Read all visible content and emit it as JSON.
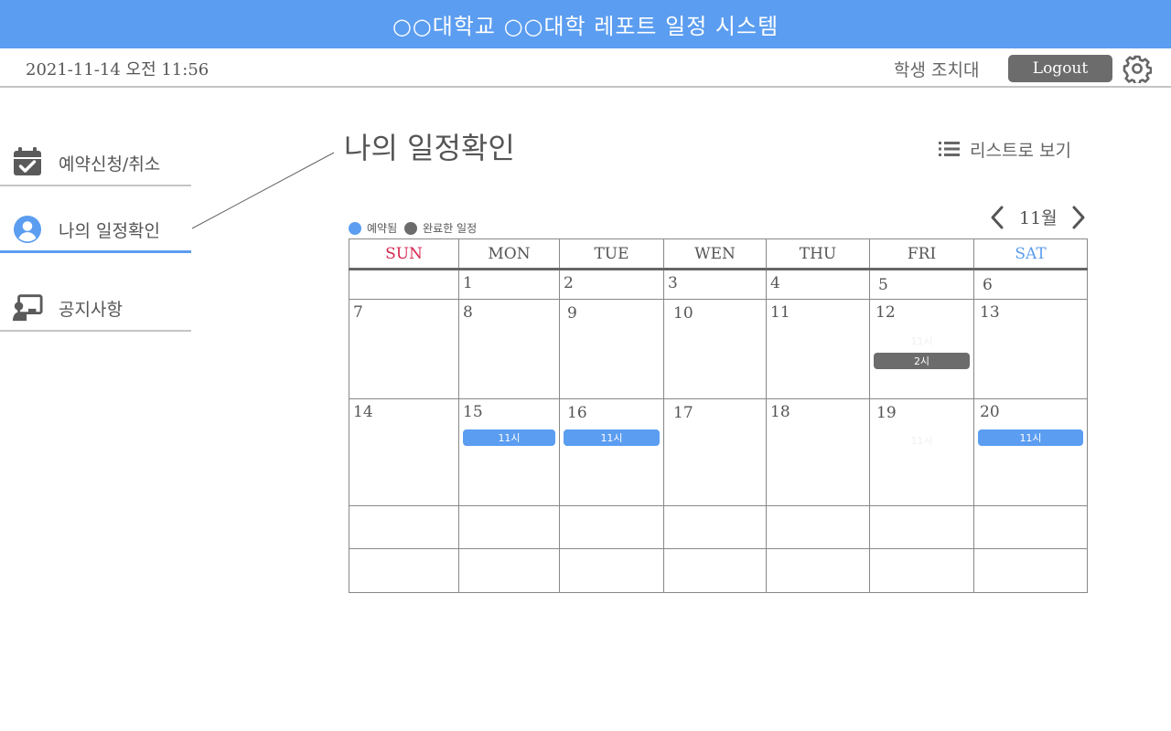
{
  "app": {
    "title": "○○대학교 ○○대학 레포트 일정 시스템"
  },
  "header": {
    "datetime": "2021-11-14 오전 11:56",
    "user": "학생 조치대",
    "logout_label": "Logout"
  },
  "sidebar": {
    "items": [
      {
        "label": "예약신청/취소",
        "icon": "calendar-check-icon"
      },
      {
        "label": "나의 일정확인",
        "icon": "user-circle-icon"
      },
      {
        "label": "공지사항",
        "icon": "teacher-board-icon"
      }
    ]
  },
  "main": {
    "title": "나의 일정확인",
    "list_view_label": "리스트로 보기",
    "legend": [
      {
        "label": "예약됨",
        "color": "#5b9df0"
      },
      {
        "label": "완료한 일정",
        "color": "#6c6c6c"
      }
    ],
    "month_label": "11월"
  },
  "calendar": {
    "weekdays": [
      "SUN",
      "MON",
      "TUE",
      "WEN",
      "THU",
      "FRI",
      "SAT"
    ],
    "weekday_colors": {
      "SUN": "#d6264f",
      "SAT": "#5b9df0"
    },
    "weeks": [
      [
        {
          "day": ""
        },
        {
          "day": "1"
        },
        {
          "day": "2"
        },
        {
          "day": "3"
        },
        {
          "day": "4"
        },
        {
          "day": "5"
        },
        {
          "day": "6"
        }
      ],
      [
        {
          "day": "7"
        },
        {
          "day": "8"
        },
        {
          "day": "9"
        },
        {
          "day": "10"
        },
        {
          "day": "11"
        },
        {
          "day": "12",
          "ghost": "11시",
          "events": [
            {
              "label": "2시",
              "status": "completed"
            }
          ]
        },
        {
          "day": "13"
        }
      ],
      [
        {
          "day": "14"
        },
        {
          "day": "15",
          "events": [
            {
              "label": "11시",
              "status": "reserved"
            }
          ]
        },
        {
          "day": "16",
          "events": [
            {
              "label": "11시",
              "status": "reserved"
            }
          ]
        },
        {
          "day": "17"
        },
        {
          "day": "18"
        },
        {
          "day": "19",
          "ghost": "11시"
        },
        {
          "day": "20",
          "events": [
            {
              "label": "11시",
              "status": "reserved"
            }
          ]
        }
      ],
      [
        {
          "day": ""
        },
        {
          "day": ""
        },
        {
          "day": ""
        },
        {
          "day": ""
        },
        {
          "day": ""
        },
        {
          "day": ""
        },
        {
          "day": ""
        }
      ],
      [
        {
          "day": ""
        },
        {
          "day": ""
        },
        {
          "day": ""
        },
        {
          "day": ""
        },
        {
          "day": ""
        },
        {
          "day": ""
        },
        {
          "day": ""
        }
      ]
    ]
  }
}
